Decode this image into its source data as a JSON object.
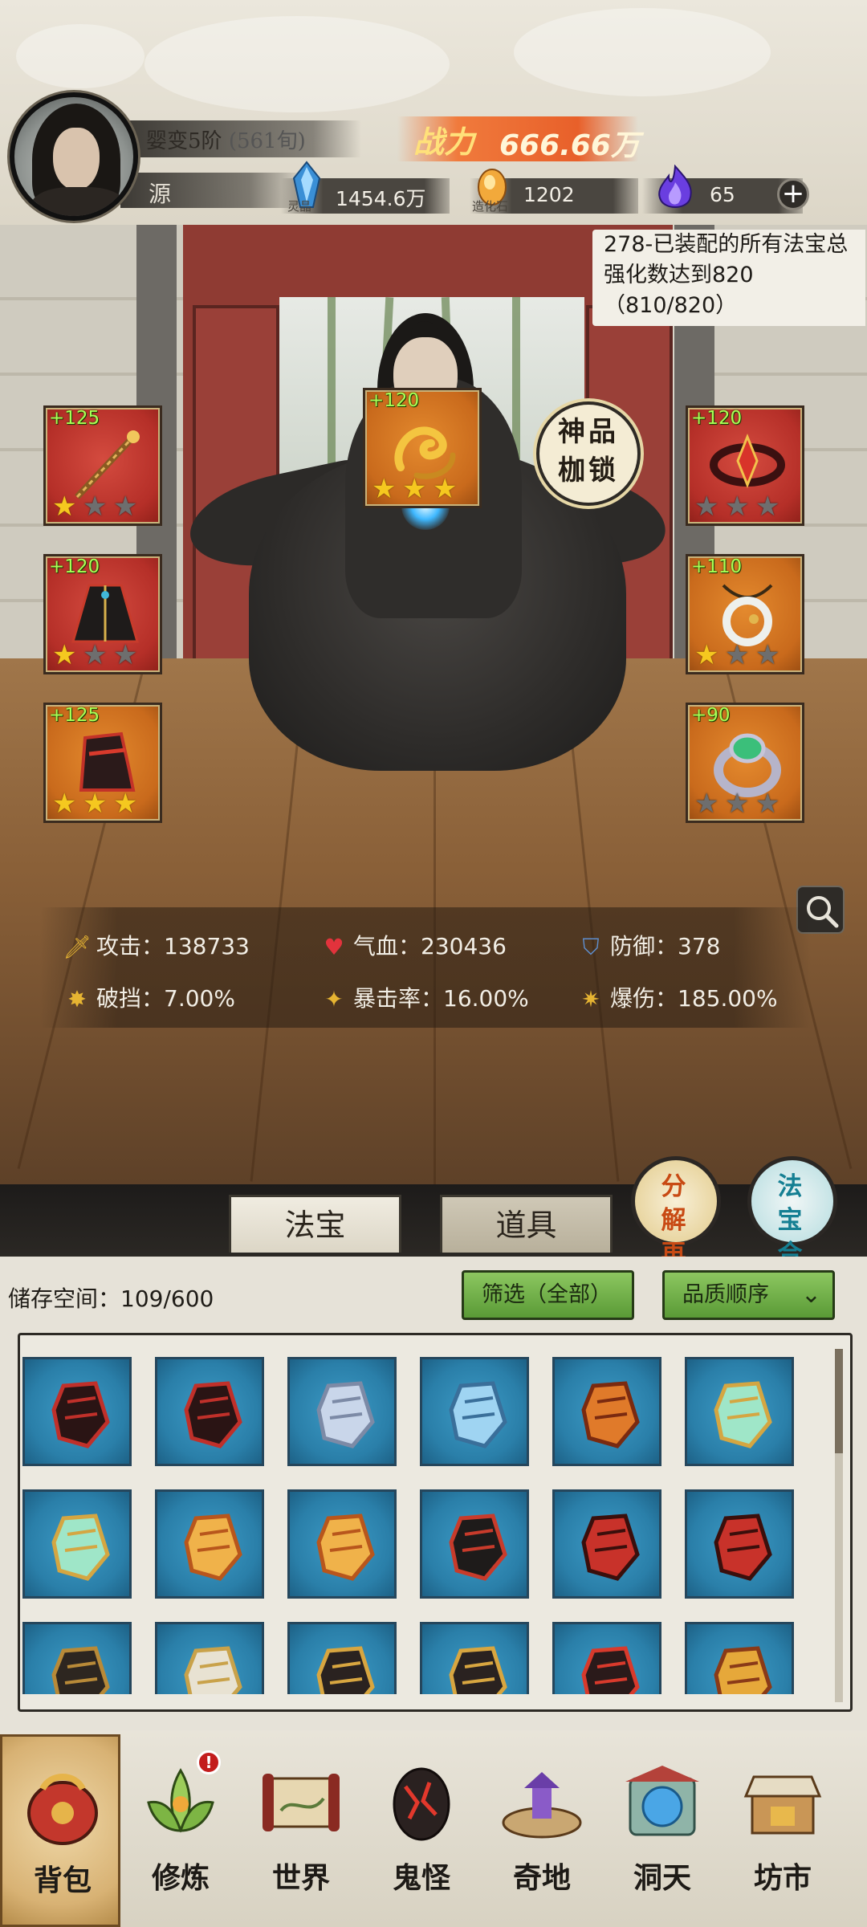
{
  "player": {
    "realm": "婴变5阶",
    "realm_sub": "(561旬)",
    "name": "源",
    "power_label": "战力",
    "power_value": "666.66万"
  },
  "resources": [
    {
      "icon": "blue-crystal-icon",
      "caption": "灵晶",
      "value": "1454.6万"
    },
    {
      "icon": "orange-stone-icon",
      "caption": "造化石",
      "value": "1202"
    },
    {
      "icon": "purple-flame-icon",
      "caption": "",
      "value": "65"
    }
  ],
  "quest": {
    "text": "278-已装配的所有法宝总强化数达到820（810/820）"
  },
  "equipment": [
    {
      "slot": "left-top",
      "level": "+125",
      "stars": 1,
      "color": "#c2362e",
      "icon": "staff-icon"
    },
    {
      "slot": "center-top",
      "level": "+120",
      "stars": 3,
      "color": "#d6762a",
      "icon": "golden-dragon-icon"
    },
    {
      "slot": "right-top",
      "level": "+120",
      "stars": 0,
      "color": "#c2362e",
      "icon": "crown-icon"
    },
    {
      "slot": "left-mid",
      "level": "+120",
      "stars": 1,
      "color": "#c2362e",
      "icon": "robe-icon"
    },
    {
      "slot": "right-mid",
      "level": "+110",
      "stars": 1,
      "color": "#d6762a",
      "icon": "pendant-icon"
    },
    {
      "slot": "left-bottom",
      "level": "+125",
      "stars": 3,
      "color": "#d6762a",
      "icon": "boots-icon"
    },
    {
      "slot": "right-bottom",
      "level": "+90",
      "stars": 0,
      "color": "#d6762a",
      "icon": "ring-icon"
    }
  ],
  "special_badge": "神品枷锁",
  "stats": [
    {
      "icon": "sword-icon",
      "label": "攻击：138733"
    },
    {
      "icon": "heart-icon",
      "label": "气血：230436"
    },
    {
      "icon": "shield-icon",
      "label": "防御：378"
    },
    {
      "icon": "break-icon",
      "label": "破挡：7.00%"
    },
    {
      "icon": "crit-icon",
      "label": "暴击率：16.00%"
    },
    {
      "icon": "crit-dmg-icon",
      "label": "爆伤：185.00%"
    }
  ],
  "tabs": [
    {
      "label": "法宝",
      "active": true
    },
    {
      "label": "道具",
      "active": false
    }
  ],
  "round_buttons": {
    "decompose": "分解再造",
    "synthesize": "法宝合成"
  },
  "inventory": {
    "storage_label": "储存空间：109/600",
    "filter_label": "筛选（全部）",
    "sort_label": "品质顺序",
    "items": [
      {
        "icon": "dark-boot-icon"
      },
      {
        "icon": "dark-boot-icon"
      },
      {
        "icon": "sword-icon"
      },
      {
        "icon": "bow-icon"
      },
      {
        "icon": "axe-icon"
      },
      {
        "icon": "jade-fan-icon"
      },
      {
        "icon": "jade-fan-icon"
      },
      {
        "icon": "golden-armor-icon"
      },
      {
        "icon": "golden-armor-icon"
      },
      {
        "icon": "dark-robe-icon"
      },
      {
        "icon": "demon-mask-icon"
      },
      {
        "icon": "demon-mask-icon"
      },
      {
        "icon": "dark-cloak-icon"
      },
      {
        "icon": "white-armor-icon"
      },
      {
        "icon": "bracer-icon"
      },
      {
        "icon": "bracer-icon"
      },
      {
        "icon": "red-boot-icon"
      },
      {
        "icon": "golden-beast-icon"
      }
    ]
  },
  "nav": [
    {
      "label": "背包",
      "icon": "bag-icon",
      "active": true
    },
    {
      "label": "修炼",
      "icon": "lotus-icon",
      "active": false,
      "badge": "!"
    },
    {
      "label": "世界",
      "icon": "scroll-map-icon",
      "active": false
    },
    {
      "label": "鬼怪",
      "icon": "demon-egg-icon",
      "active": false
    },
    {
      "label": "奇地",
      "icon": "pagoda-icon",
      "active": false
    },
    {
      "label": "洞天",
      "icon": "portal-icon",
      "active": false
    },
    {
      "label": "坊市",
      "icon": "market-icon",
      "active": false
    }
  ]
}
